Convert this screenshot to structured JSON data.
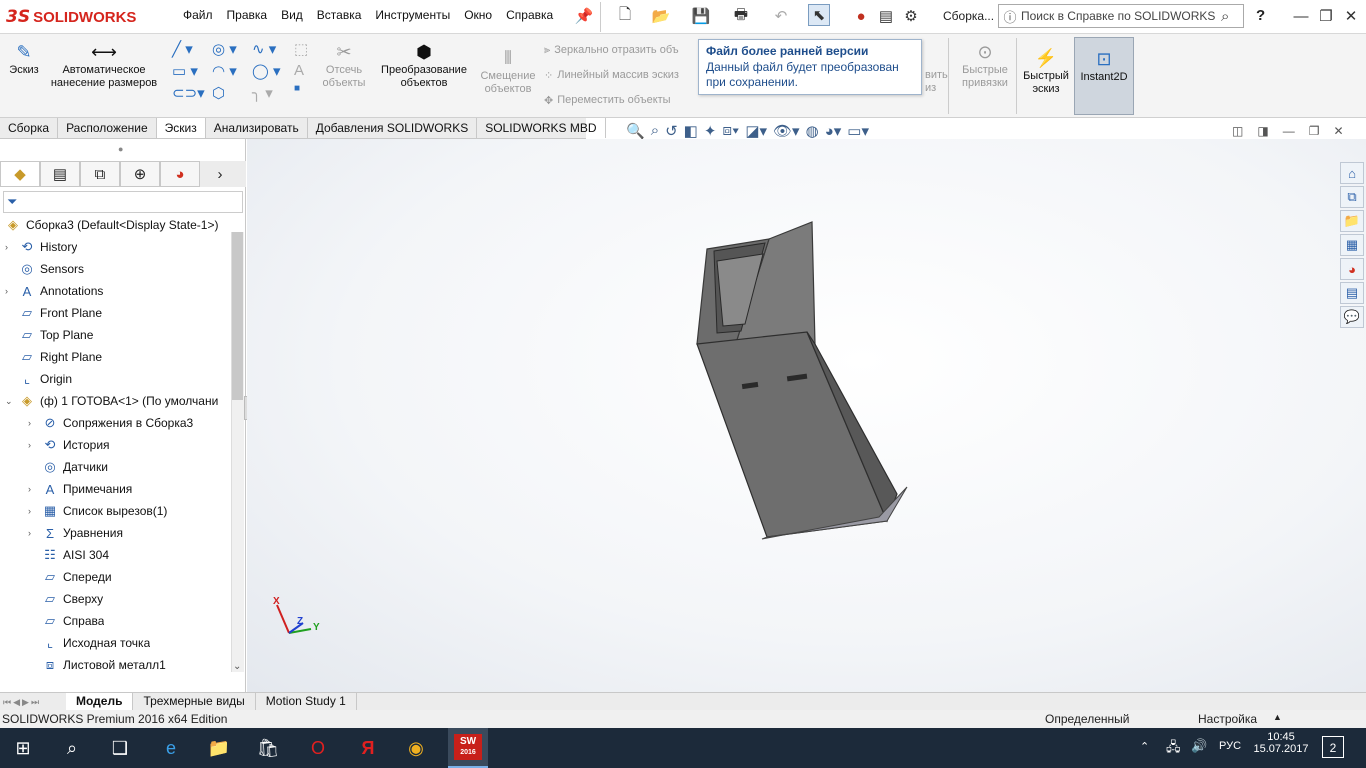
{
  "app": {
    "logo_ds": "3S",
    "logo_text": "SOLIDWORKS"
  },
  "menu": [
    "Файл",
    "Правка",
    "Вид",
    "Вставка",
    "Инструменты",
    "Окно",
    "Справка"
  ],
  "titlebar": {
    "doc_title": "Сборка...",
    "search_placeholder": "Поиск в Справке по SOLIDWORKS",
    "help_label": "?"
  },
  "commands": {
    "sketch": "Эскиз",
    "smart_dim_line1": "Автоматическое",
    "smart_dim_line2": "нанесение размеров",
    "trim_line1": "Отсечь",
    "trim_line2": "объекты",
    "convert_line1": "Преобразование",
    "convert_line2": "объектов",
    "offset_line1": "Смещение",
    "offset_line2": "объектов",
    "mirror": "Зеркально отразить объ",
    "linear_pattern": "Линейный массив эскиз",
    "move": "Переместить объекты",
    "snaps_line1": "Быстрые",
    "snaps_line2": "привязки",
    "rapid_sketch_line1": "Быстрый",
    "rapid_sketch_line2": "эскиз",
    "instant2d": "Instant2D",
    "partial_hidden_1": "вить",
    "partial_hidden_2": "из"
  },
  "tooltip": {
    "title": "Файл более ранней версии",
    "line1": "Данный файл будет преобразован",
    "line2": "при сохранении."
  },
  "tabs": [
    {
      "label": "Сборка",
      "active": false
    },
    {
      "label": "Расположение",
      "active": false
    },
    {
      "label": "Эскиз",
      "active": true
    },
    {
      "label": "Анализировать",
      "active": false
    },
    {
      "label": "Добавления SOLIDWORKS",
      "active": false
    },
    {
      "label": "SOLIDWORKS MBD",
      "active": false
    }
  ],
  "tree": {
    "root": "Сборка3  (Default<Display State-1>)",
    "items": [
      {
        "label": "History",
        "indent": 0,
        "arrow": true,
        "icon": "history-icon"
      },
      {
        "label": "Sensors",
        "indent": 0,
        "arrow": false,
        "icon": "sensors-icon"
      },
      {
        "label": "Annotations",
        "indent": 0,
        "arrow": true,
        "icon": "annotations-icon"
      },
      {
        "label": "Front Plane",
        "indent": 0,
        "arrow": false,
        "icon": "plane-icon"
      },
      {
        "label": "Top Plane",
        "indent": 0,
        "arrow": false,
        "icon": "plane-icon"
      },
      {
        "label": "Right Plane",
        "indent": 0,
        "arrow": false,
        "icon": "plane-icon"
      },
      {
        "label": "Origin",
        "indent": 0,
        "arrow": false,
        "icon": "origin-icon"
      },
      {
        "label": "(ф) 1 ГОТОВА<1> (По умолчани",
        "indent": 0,
        "arrow": true,
        "expanded": true,
        "icon": "part-icon"
      },
      {
        "label": "Сопряжения в Сборка3",
        "indent": 1,
        "arrow": true,
        "icon": "mates-icon"
      },
      {
        "label": "История",
        "indent": 1,
        "arrow": true,
        "icon": "history-icon"
      },
      {
        "label": "Датчики",
        "indent": 1,
        "arrow": false,
        "icon": "sensors-icon"
      },
      {
        "label": "Примечания",
        "indent": 1,
        "arrow": true,
        "icon": "annotations-icon"
      },
      {
        "label": "Список вырезов(1)",
        "indent": 1,
        "arrow": true,
        "icon": "cutlist-icon"
      },
      {
        "label": "Уравнения",
        "indent": 1,
        "arrow": true,
        "icon": "equations-icon"
      },
      {
        "label": "AISI 304",
        "indent": 1,
        "arrow": false,
        "icon": "material-icon"
      },
      {
        "label": "Спереди",
        "indent": 1,
        "arrow": false,
        "icon": "plane-icon"
      },
      {
        "label": "Сверху",
        "indent": 1,
        "arrow": false,
        "icon": "plane-icon"
      },
      {
        "label": "Справа",
        "indent": 1,
        "arrow": false,
        "icon": "plane-icon"
      },
      {
        "label": "Исходная точка",
        "indent": 1,
        "arrow": false,
        "icon": "origin-icon"
      },
      {
        "label": "Листовой металл1",
        "indent": 1,
        "arrow": false,
        "icon": "sheetmetal-icon"
      }
    ]
  },
  "triad": {
    "x": "X",
    "y": "Y",
    "z": "Z"
  },
  "bottom_tabs": [
    {
      "label": "Модель",
      "active": true
    },
    {
      "label": "Трехмерные виды",
      "active": false
    },
    {
      "label": "Motion Study 1",
      "active": false
    }
  ],
  "status": {
    "edition": "SOLIDWORKS Premium 2016 x64 Edition",
    "state": "Определенный",
    "custom": "Настройка"
  },
  "taskbar": {
    "lang": "РУС",
    "time": "10:45",
    "date": "15.07.2017",
    "notifications": "2",
    "sw_label": "SW",
    "sw_year": "2016",
    "yandex": "Я"
  }
}
